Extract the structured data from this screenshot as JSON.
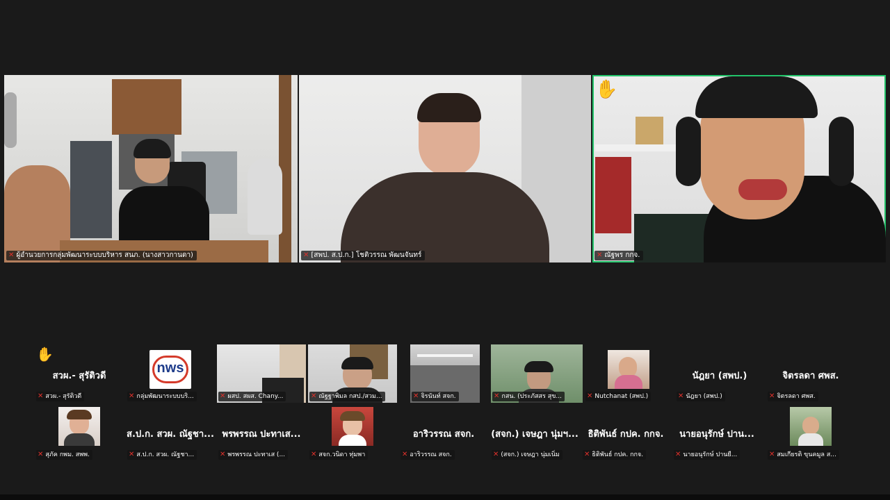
{
  "main_tiles": [
    {
      "name": "ผู้อำนวยการกลุ่มพัฒนาระบบบริหาร สนภ. (นางสาวกานดา)",
      "muted": true
    },
    {
      "name": "[สพป. ส.ป.ก.] โชติวรรณ พัฒนจันทร์",
      "muted": true
    },
    {
      "name": "ณัฐพร กกจ.",
      "muted": true,
      "hand_raised": true,
      "active_speaker": true
    }
  ],
  "gallery": {
    "row1": [
      {
        "display_name": "สวผ.- สุรัติวดี",
        "tag": "สวผ.- สุรัติวดี",
        "hand_raised": true
      },
      {
        "display_name": "",
        "tag": "กลุ่มพัฒนาระบบบริ...",
        "logo_text": "nws"
      },
      {
        "display_name": "",
        "tag": "ผสป. สผส. Chany..."
      },
      {
        "display_name": "",
        "tag": "ณัฐฐาพิมล กสป./สวม..."
      },
      {
        "display_name": "",
        "tag": "จิรนันท์ สจก."
      },
      {
        "display_name": "",
        "tag": "กสน. (ประภัสสร สุข..."
      },
      {
        "display_name": "",
        "tag": "Nutchanat (สพป.)"
      },
      {
        "display_name": "นัฎยา (สพป.)",
        "tag": "นัฎยา (สพป.)"
      },
      {
        "display_name": "จิตรลดา ศพส.",
        "tag": "จิตรลดา ศพส."
      }
    ],
    "row2": [
      {
        "display_name": "",
        "tag": "สุภัค กพม. สพพ."
      },
      {
        "display_name": "ส.ป.ก. สวผ. ณัฐชา...",
        "tag": "ส.ป.ก. สวผ. ณัฐชา..."
      },
      {
        "display_name": "พรพรรณ ปะทาเส...",
        "tag": "พรพรรณ ปะทาเส (..."
      },
      {
        "display_name": "",
        "tag": "สจก.วนิดา ทุ่มพา"
      },
      {
        "display_name": "อาริวรรณ สจก.",
        "tag": "อาริวรรณ สจก."
      },
      {
        "display_name": "(สจก.) เจษฎา นุ่มฯ...",
        "tag": "(สจก.) เจษฎา นุ่มเนิ่ม"
      },
      {
        "display_name": "ธิติพันธ์ กปค. กกจ.",
        "tag": "ธิติพันธ์ กปค. กกจ."
      },
      {
        "display_name": "นายอนุรักษ์ ปาน...",
        "tag": "นายอนุรักษ์ ปานยื..."
      },
      {
        "display_name": "",
        "tag": "สมเกียรติ ขุนคมูล ส..."
      }
    ]
  },
  "colors": {
    "active_speaker_border": "#22c46a",
    "muted_icon": "#e0312b",
    "background": "#1a1a1a"
  },
  "icons": {
    "mic_muted": "mic-muted-icon",
    "hand": "raised-hand-icon"
  }
}
